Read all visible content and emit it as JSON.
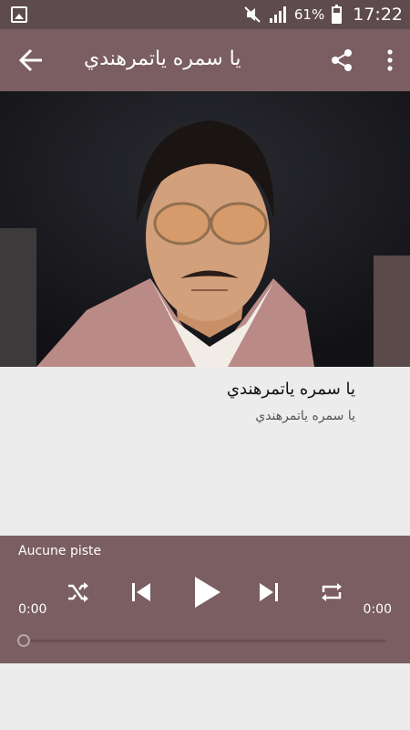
{
  "status_bar": {
    "battery": "61%",
    "time": "17:22"
  },
  "toolbar": {
    "title": "يا سمره ياتمرهندي"
  },
  "song": {
    "title": "يا سمره ياتمرهندي",
    "artist": "يا سمره ياتمرهندي"
  },
  "player": {
    "track_label": "Aucune piste",
    "elapsed": "0:00",
    "duration": "0:00",
    "progress": 0
  },
  "colors": {
    "status_bar": "#5e4b4e",
    "accent": "#7a5e61",
    "background": "#ececec"
  }
}
